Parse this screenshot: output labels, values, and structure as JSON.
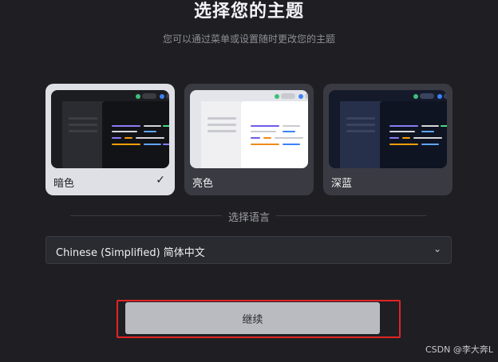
{
  "header": {
    "title": "选择您的主题",
    "subtitle": "您可以通过菜单或设置随时更改您的主题"
  },
  "themes": [
    {
      "label": "暗色",
      "selected": true
    },
    {
      "label": "亮色",
      "selected": false
    },
    {
      "label": "深蓝",
      "selected": false
    }
  ],
  "selected_check": "✓",
  "language": {
    "section_title": "选择语言",
    "selected_value": "Chinese (Simplified) 简体中文"
  },
  "actions": {
    "continue_label": "继续"
  },
  "watermark": "CSDN @李大奔L",
  "colors": {
    "background": "#1f1f23",
    "card_bg": "#3a3b42",
    "card_selected_bg": "#dfe0e6",
    "highlight_border": "#e02424",
    "button_bg": "#b9bbc1"
  }
}
